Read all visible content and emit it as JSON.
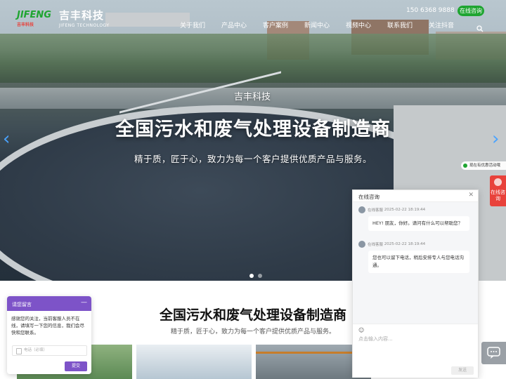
{
  "header": {
    "logo_mark": "JIFENG",
    "logo_mark_small": "吉丰科技",
    "logo_cn": "吉丰科技",
    "logo_en": "JIFENG TECHNOLOGY",
    "nav": [
      "关于我们",
      "产品中心",
      "客户案例",
      "新闻中心",
      "视频中心",
      "联系我们",
      "关注抖音"
    ],
    "phone": "150 6368 9888",
    "consult_label": "在线咨询"
  },
  "hero": {
    "kicker": "吉丰科技",
    "title": "全国污水和废气处理设备制造商",
    "subtitle": "精于质，匠于心，致力为每一个客户提供优质产品与服务。"
  },
  "section": {
    "title": "全国污水和废气处理设备制造商",
    "subtitle": "精于质，匠于心，致力为每一个客户提供优质产品与服务。"
  },
  "chat": {
    "header": "在线咨询",
    "messages": [
      {
        "sender": "在线客服",
        "time": "2025-02-22 18:19:44",
        "text": "HEY! 朋友，你好。请问有什么可以帮助您？"
      },
      {
        "sender": "在线客服",
        "time": "2025-02-22 18:19:44",
        "text": "您也可以留下电话，稍后安排专人与您电话沟通。"
      }
    ],
    "input_placeholder": "点击输入内容...",
    "send_label": "发送"
  },
  "side": {
    "activity": "现在有优惠活动哦",
    "online_consult": "在线咨询"
  },
  "leave_message": {
    "title": "请您留言",
    "text": "感谢您的关注，当前客服人员不在线，请填写一下您的信息，我们会尽快和您联系。",
    "phone_placeholder": "电话（必填）",
    "submit_label": "提交"
  }
}
